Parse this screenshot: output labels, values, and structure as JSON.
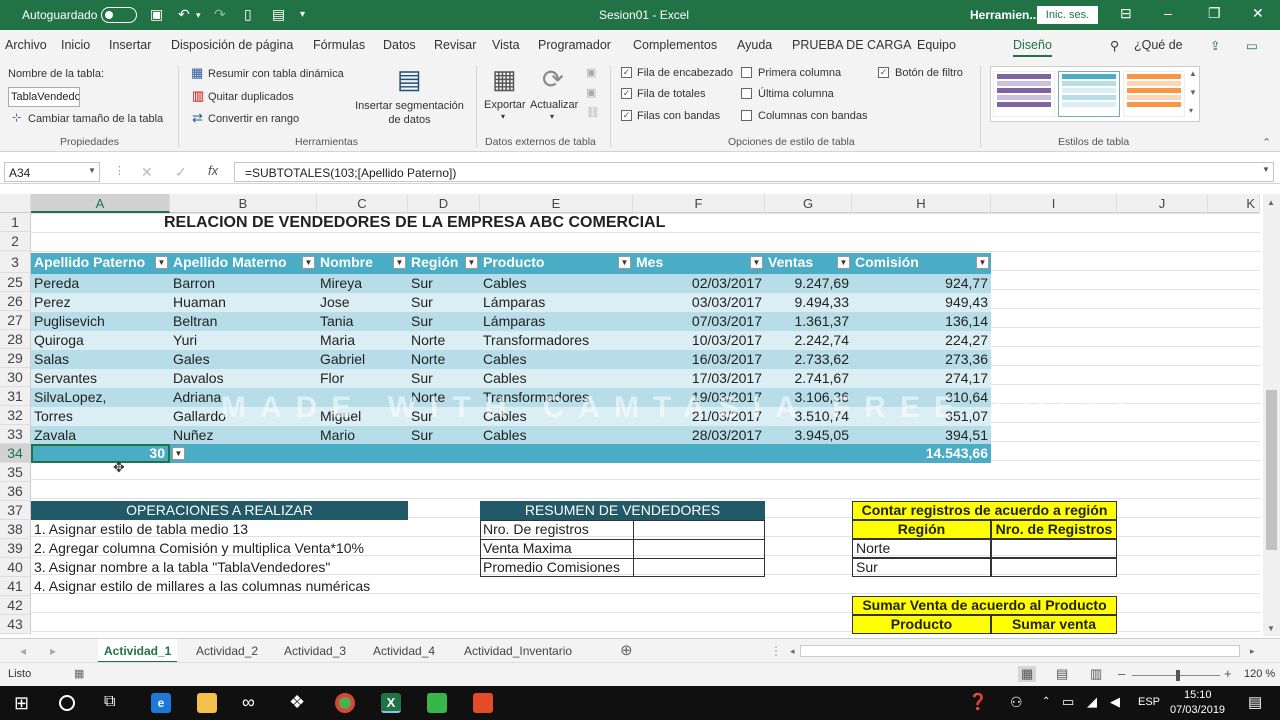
{
  "titlebar": {
    "autosave": "Autoguardado",
    "filename": "Sesion01 - Excel",
    "tools": "Herramien...",
    "signin": "Inic. ses."
  },
  "menu": [
    "Archivo",
    "Inicio",
    "Insertar",
    "Disposición de página",
    "Fórmulas",
    "Datos",
    "Revisar",
    "Vista",
    "Programador",
    "Complementos",
    "Ayuda",
    "PRUEBA DE CARGA",
    "Equipo",
    "Diseño"
  ],
  "search_label": "¿Qué de",
  "ribbon": {
    "props": {
      "name_label": "Nombre de la tabla:",
      "name_value": "TablaVendedc",
      "resize": "Cambiar tamaño de la tabla",
      "group": "Propiedades"
    },
    "tools": {
      "pivot": "Resumir con tabla dinámica",
      "dup": "Quitar duplicados",
      "range": "Convertir en rango",
      "slicer": "Insertar segmentación de datos",
      "group": "Herramientas"
    },
    "external": {
      "export": "Exportar",
      "refresh": "Actualizar",
      "group": "Datos externos de tabla"
    },
    "options": {
      "header_row": "Fila de encabezado",
      "total_row": "Fila de totales",
      "banded_rows": "Filas con bandas",
      "first_col": "Primera columna",
      "last_col": "Última columna",
      "banded_cols": "Columnas con bandas",
      "filter_btn": "Botón de filtro",
      "group": "Opciones de estilo de tabla"
    },
    "styles": {
      "group": "Estilos de tabla"
    }
  },
  "formula": {
    "namebox": "A34",
    "content": "=SUBTOTALES(103;[Apellido Paterno])"
  },
  "columns": [
    "A",
    "B",
    "C",
    "D",
    "E",
    "F",
    "G",
    "H",
    "I",
    "J",
    "K"
  ],
  "rownums": [
    "1",
    "2",
    "3",
    "25",
    "26",
    "27",
    "28",
    "29",
    "30",
    "31",
    "32",
    "33",
    "34",
    "35",
    "36",
    "37",
    "38",
    "39",
    "40",
    "41",
    "42",
    "43"
  ],
  "title": "RELACION DE VENDEDORES DE LA EMPRESA ABC COMERCIAL",
  "table_headers": [
    "Apellido Paterno",
    "Apellido Materno",
    "Nombre",
    "Región",
    "Producto",
    "Mes",
    "Ventas",
    "Comisión"
  ],
  "rows": [
    [
      "Pereda",
      "Barron",
      "Mireya",
      "Sur",
      "Cables",
      "02/03/2017",
      "9.247,69",
      "924,77"
    ],
    [
      "Perez",
      "Huaman",
      "Jose",
      "Sur",
      "Lámparas",
      "03/03/2017",
      "9.494,33",
      "949,43"
    ],
    [
      "Puglisevich",
      "Beltran",
      "Tania",
      "Sur",
      "Lámparas",
      "07/03/2017",
      "1.361,37",
      "136,14"
    ],
    [
      "Quiroga",
      "Yuri",
      "Maria",
      "Norte",
      "Transformadores",
      "10/03/2017",
      "2.242,74",
      "224,27"
    ],
    [
      "Salas",
      "Gales",
      "Gabriel",
      "Norte",
      "Cables",
      "16/03/2017",
      "2.733,62",
      "273,36"
    ],
    [
      "Servantes",
      "Davalos",
      "Flor",
      "Sur",
      "Cables",
      "17/03/2017",
      "2.741,67",
      "274,17"
    ],
    [
      "SilvaLopez,",
      "Adriana",
      "",
      "Norte",
      "Transformadores",
      "19/03/2017",
      "3.106,36",
      "310,64"
    ],
    [
      "Torres",
      "Gallardo",
      "Miguel",
      "Sur",
      "Cables",
      "21/03/2017",
      "3.510,74",
      "351,07"
    ],
    [
      "Zavala",
      "Nuñez",
      "Mario",
      "Sur",
      "Cables",
      "28/03/2017",
      "3.945,05",
      "394,51"
    ]
  ],
  "totals": {
    "count": "30",
    "commission": "14.543,66"
  },
  "operations": {
    "title": "OPERACIONES A REALIZAR",
    "items": [
      "1. Asignar estilo de tabla medio 13",
      "2. Agregar columna Comisión y multiplica Venta*10%",
      "3. Asignar nombre a la tabla \"TablaVendedores\"",
      "4. Asignar estilo de  millares a las columnas numéricas"
    ]
  },
  "summary": {
    "title": "RESUMEN DE VENDEDORES",
    "items": [
      "Nro. De registros",
      "Venta Maxima",
      "Promedio Comisiones"
    ]
  },
  "count_region": {
    "title": "Contar registros de acuerdo a región",
    "col1": "Región",
    "col2": "Nro. de Registros",
    "items": [
      "Norte",
      "Sur"
    ]
  },
  "sum_product": {
    "title": "Sumar Venta de acuerdo al Producto",
    "col1": "Producto",
    "col2": "Sumar venta"
  },
  "watermark": "MADE WITH CAMTASIA FREE TRIAL",
  "sheets": [
    "Actividad_1",
    "Actividad_2",
    "Actividad_3",
    "Actividad_4",
    "Actividad_Inventario"
  ],
  "status": {
    "ready": "Listo",
    "zoom": "120 %"
  },
  "taskbar": {
    "lang": "ESP",
    "time": "15:10",
    "date": "07/03/2019"
  },
  "colors": {
    "excel_green": "#217346",
    "table_header": "#4bacc6",
    "band_dark": "#b7dee8",
    "band_light": "#dbeef3",
    "ops_header": "#215967",
    "yellow": "#ffff00"
  }
}
